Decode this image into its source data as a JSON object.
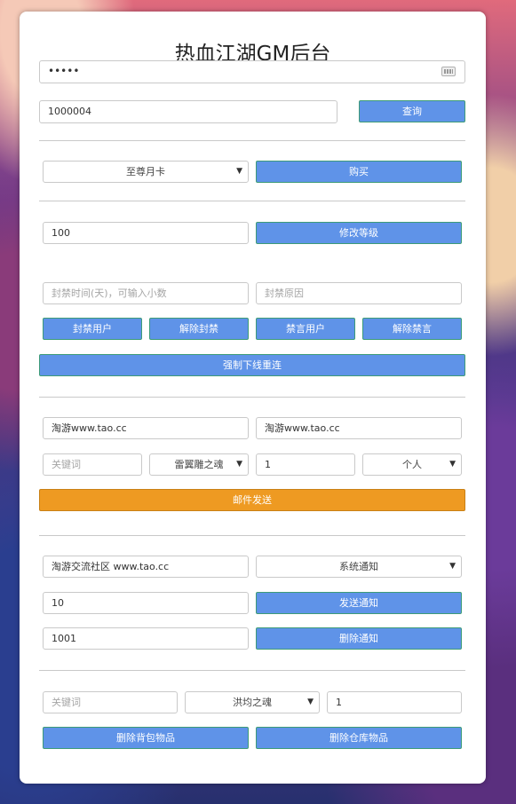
{
  "title": "热血江湖GM后台",
  "password": {
    "value": "•••••"
  },
  "query": {
    "id_value": "1000004",
    "button": "查询"
  },
  "card": {
    "selected": "至尊月卡",
    "button": "购买"
  },
  "level": {
    "value": "100",
    "button": "修改等级"
  },
  "ban": {
    "time_placeholder": "封禁时间(天)，可输入小数",
    "reason_placeholder": "封禁原因",
    "buttons": [
      "封禁用户",
      "解除封禁",
      "禁言用户",
      "解除禁言"
    ],
    "force_offline": "强制下线重连"
  },
  "mail": {
    "sender": "淘游www.tao.cc",
    "title": "淘游www.tao.cc",
    "keyword_placeholder": "关键词",
    "item_selected": "雷翼雕之魂",
    "count": "1",
    "scope_selected": "个人",
    "send_button": "邮件发送"
  },
  "notice": {
    "content": "淘游交流社区 www.tao.cc",
    "type_selected": "系统通知",
    "value1": "10",
    "send_button": "发送通知",
    "value2": "1001",
    "delete_button": "删除通知"
  },
  "items": {
    "keyword_placeholder": "关键词",
    "item_selected": "洪均之魂",
    "count": "1",
    "delete_bag": "删除背包物品",
    "delete_warehouse": "删除仓库物品"
  },
  "icons": {
    "keyboard": "keyboard-icon",
    "dropdown": "chevron-down-icon"
  },
  "colors": {
    "primary_button": "#5f93e8",
    "mail_button": "#ee9a22"
  }
}
